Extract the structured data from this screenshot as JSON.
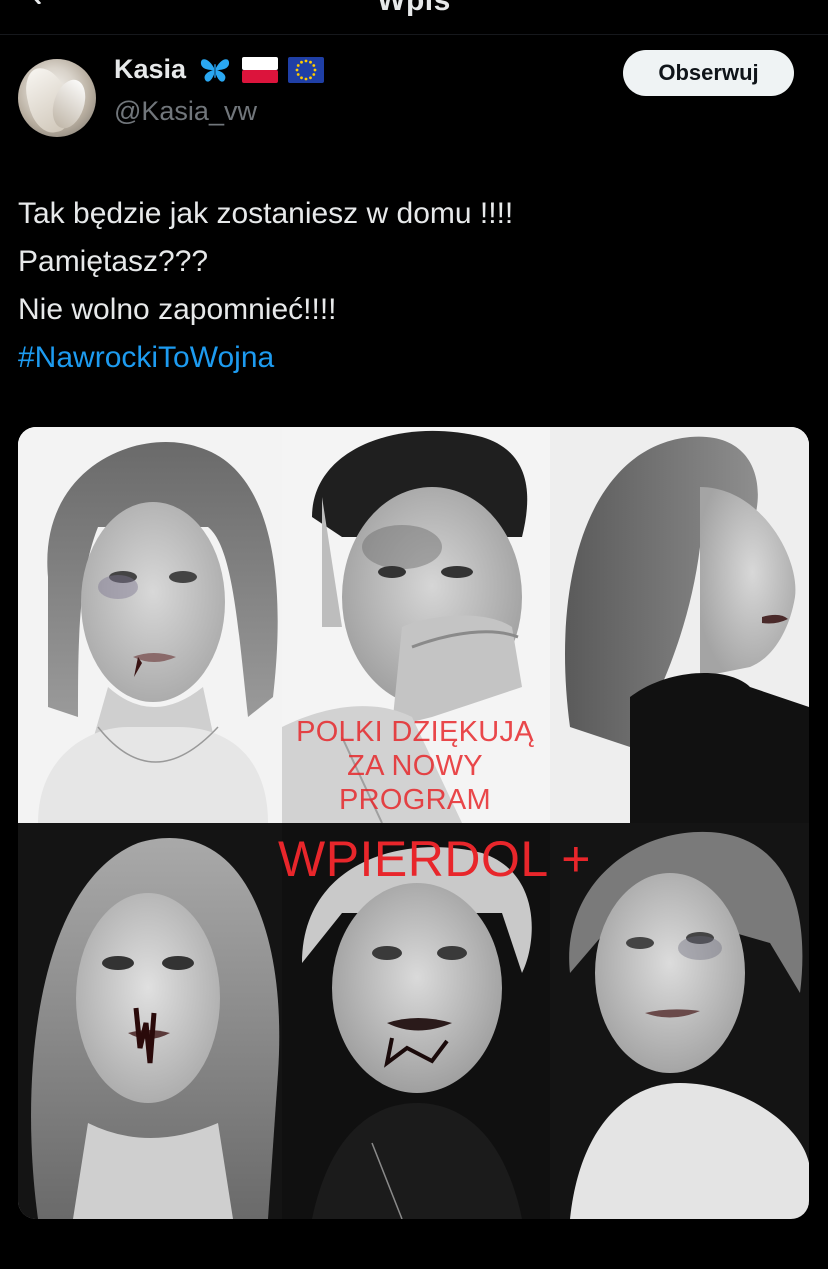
{
  "nav": {
    "title": "Wpis"
  },
  "author": {
    "display_name": "Kasia",
    "handle": "@Kasia_vw",
    "badges": [
      "butterfly-emoji",
      "poland-flag-emoji",
      "eu-flag-emoji"
    ]
  },
  "follow_button": {
    "label": "Obserwuj"
  },
  "tweet": {
    "lines": [
      "Tak będzie jak zostaniesz w domu !!!!",
      "Pamiętasz???",
      "Nie wolno zapomnieć!!!!"
    ],
    "hashtag": "#NawrockiToWojna"
  },
  "media": {
    "caption_small": [
      "POLKI DZIĘKUJĄ",
      "ZA NOWY",
      "PROGRAM"
    ],
    "caption_big": "WPIERDOL +"
  },
  "colors": {
    "background": "#000000",
    "text": "#e7e9ea",
    "muted": "#71767b",
    "link": "#1d9bf0",
    "button_bg": "#eff3f4",
    "overlay_red": "#e8262b"
  }
}
